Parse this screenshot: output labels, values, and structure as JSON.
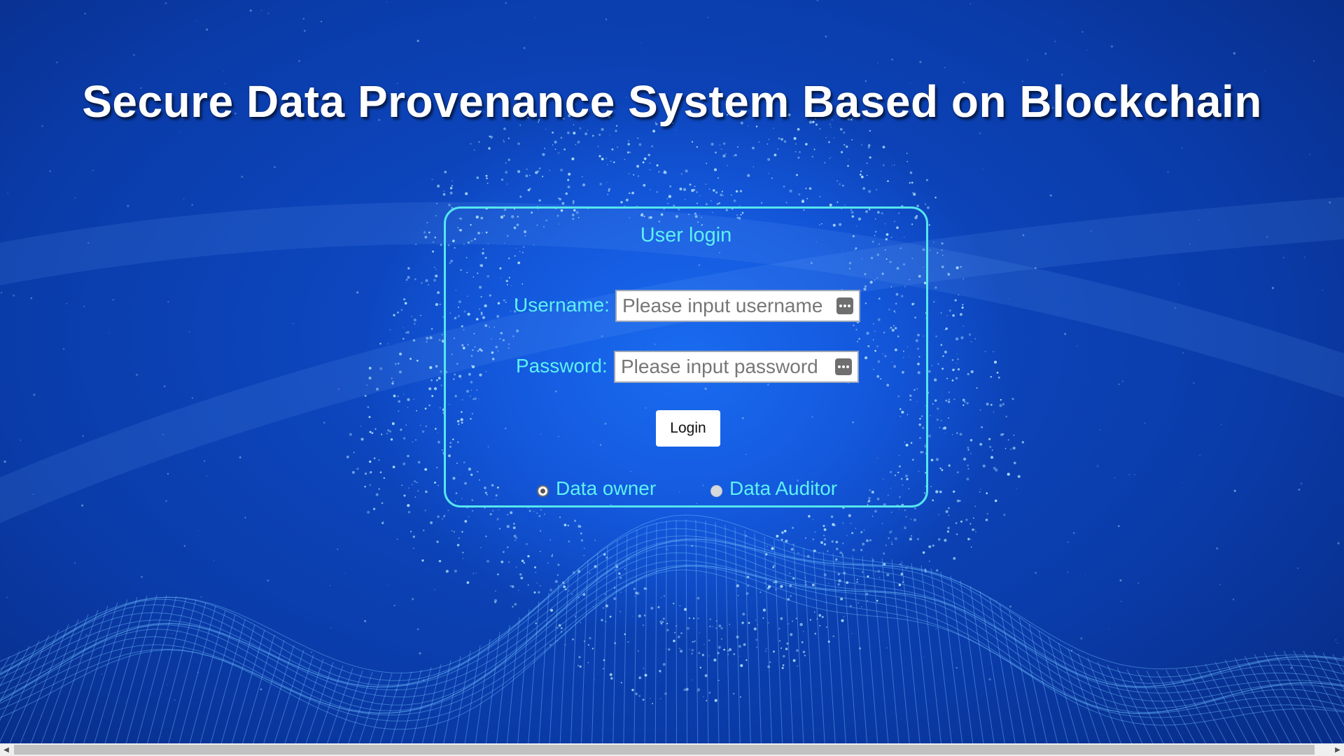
{
  "page": {
    "title": "Secure Data Provenance System Based on Blockchain"
  },
  "login": {
    "heading": "User login",
    "username": {
      "label": "Username:",
      "placeholder": "Please input username",
      "value": ""
    },
    "password": {
      "label": "Password:",
      "placeholder": "Please input password",
      "value": ""
    },
    "login_label": "Login",
    "roles": [
      {
        "label": "Data owner",
        "checked": true
      },
      {
        "label": "Data Auditor",
        "checked": false
      }
    ]
  },
  "colors": {
    "accent": "#5ef1f2",
    "panel_border": "#55e6ee",
    "background": "#0f4fd0"
  },
  "icons": {
    "field_menu": "more-dots-icon",
    "scroll_left": "chevron-left-icon",
    "scroll_right": "chevron-right-icon"
  }
}
